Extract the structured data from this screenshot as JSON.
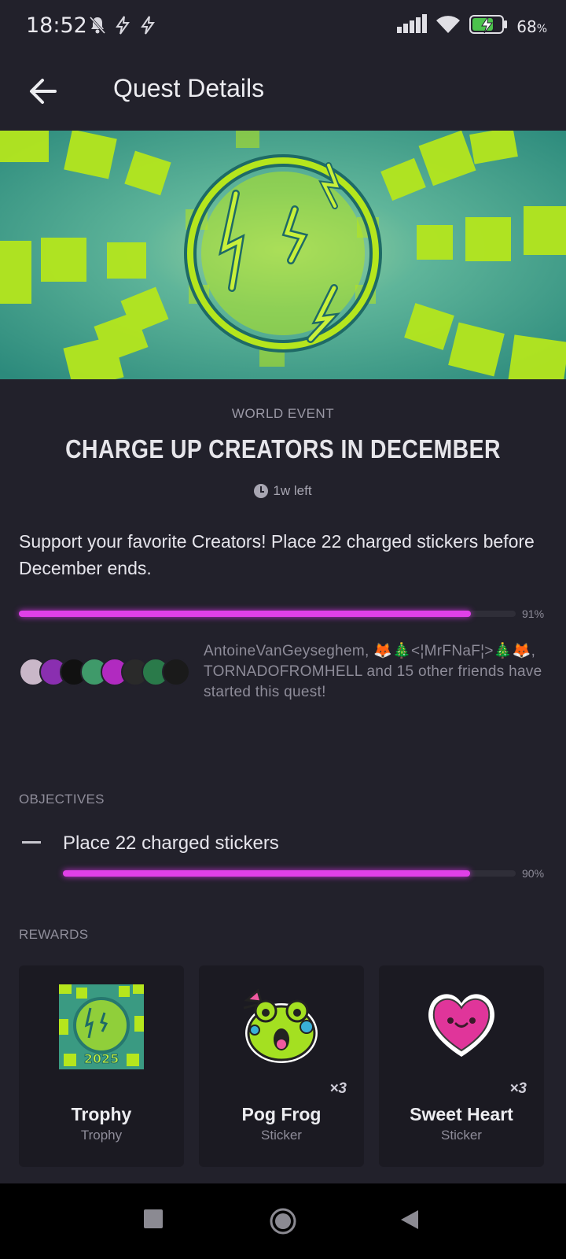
{
  "status_bar": {
    "time": "18:52",
    "battery_text": "68",
    "battery_unit": "%"
  },
  "app_bar": {
    "title": "Quest Details"
  },
  "quest": {
    "category": "WORLD EVENT",
    "title": "CHARGE UP CREATORS IN DECEMBER",
    "time_left": "1w left",
    "description": "Support your favorite Creators! Place 22 charged stickers before December ends.",
    "progress_label": "91%",
    "progress_value": 0.91,
    "friends_text": "AntoineVanGeyseghem, 🦊🎄<¦MrFNaF¦>🎄🦊, TORNADOFROMHELL and 15 other friends have started this quest!"
  },
  "objectives": {
    "label": "OBJECTIVES",
    "items": [
      {
        "text": "Place 22 charged stickers",
        "progress_label": "90%",
        "progress_value": 0.9
      }
    ]
  },
  "rewards": {
    "label": "REWARDS",
    "items": [
      {
        "name": "Trophy",
        "type": "Trophy",
        "qty": "",
        "badge_text": "2025"
      },
      {
        "name": "Pog Frog",
        "type": "Sticker",
        "qty": "×3"
      },
      {
        "name": "Sweet Heart",
        "type": "Sticker",
        "qty": "×3"
      }
    ]
  },
  "colors": {
    "background": "#22212b",
    "progress": "#e040e8",
    "accent_green": "#b5e61d",
    "teal": "#2e8a7a"
  },
  "icons": [
    "back-arrow-icon",
    "clock-icon",
    "battery-icon",
    "wifi-icon",
    "signal-icon",
    "bell-off-icon",
    "bolt-icon",
    "nav-recents-icon",
    "nav-home-icon",
    "nav-back-icon"
  ]
}
